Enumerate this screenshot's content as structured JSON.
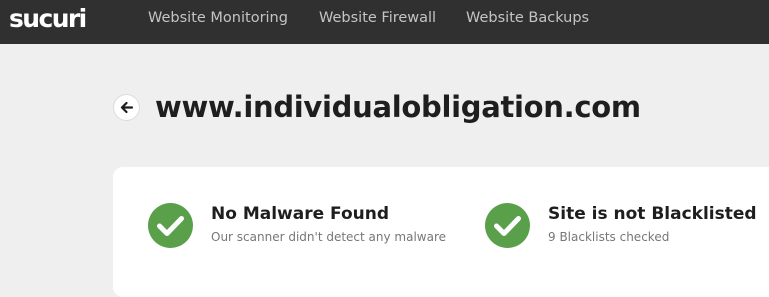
{
  "header": {
    "logo_text": "sucuri",
    "nav": [
      {
        "label": "Website Monitoring"
      },
      {
        "label": "Website Firewall"
      },
      {
        "label": "Website Backups"
      }
    ]
  },
  "main": {
    "site_url": "www.individualobligation.com",
    "back_icon": "arrow-left-icon",
    "statuses": [
      {
        "icon": "check-circle-icon",
        "title": "No Malware Found",
        "description": "Our scanner didn't detect any malware"
      },
      {
        "icon": "check-circle-icon",
        "title": "Site is not Blacklisted",
        "description": "9 Blacklists checked"
      }
    ]
  },
  "colors": {
    "topbar": "#303030",
    "background": "#efefef",
    "success_green": "#5aa04b",
    "title_text": "#1e1e1e",
    "muted_text": "#777777"
  }
}
